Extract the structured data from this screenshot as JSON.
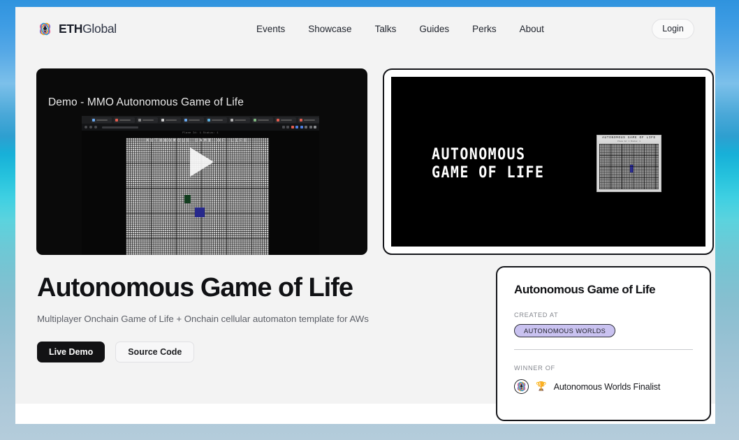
{
  "header": {
    "logo": {
      "icon": "ethglobal-logo-icon",
      "bold": "ETH",
      "regular": "Global"
    },
    "nav": [
      {
        "label": "Events"
      },
      {
        "label": "Showcase"
      },
      {
        "label": "Talks"
      },
      {
        "label": "Guides"
      },
      {
        "label": "Perks"
      },
      {
        "label": "About"
      }
    ],
    "login_label": "Login"
  },
  "video": {
    "title": "Demo - MMO Autonomous Game of Life",
    "play_icon": "play-icon",
    "inner_status": "Plane Id: 1  Status: 1",
    "inner_title": "AUTONOMOUS GAME OF LIFE"
  },
  "screenshot": {
    "wordmark_line1": "AUTONOMOUS",
    "wordmark_line2": "GAME OF LIFE",
    "mini_title": "AUTONOMOUS GAME OF LIFE",
    "mini_sub": "Plane Id: 1  Status: 1"
  },
  "project": {
    "title": "Autonomous Game of Life",
    "tagline": "Multiplayer Onchain Game of Life + Onchain cellular automaton template for AWs",
    "buttons": {
      "live_demo": "Live Demo",
      "source_code": "Source Code"
    }
  },
  "info_card": {
    "title": "Autonomous Game of Life",
    "created_at_label": "CREATED AT",
    "event_badge": "AUTONOMOUS WORLDS",
    "winner_of_label": "WINNER OF",
    "trophy_icon": "🏆",
    "award_label": "Autonomous Worlds Finalist"
  },
  "colors": {
    "page_bg": "#f3f3f3",
    "accent_dark": "#121214",
    "badge_bg": "#c9c2f0",
    "border_dark": "#15161a",
    "muted_text": "#84878e"
  }
}
